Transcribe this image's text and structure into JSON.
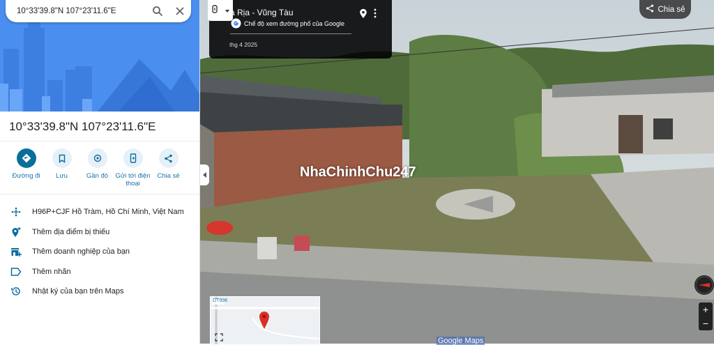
{
  "search": {
    "query": "10°33'39.8\"N 107°23'11.6\"E",
    "search_icon": "search-icon",
    "close_icon": "close-icon"
  },
  "place": {
    "title": "10°33'39.8\"N 107°23'11.6\"E"
  },
  "actions": [
    {
      "label": "Đường đi",
      "icon": "directions-icon"
    },
    {
      "label": "Lưu",
      "icon": "bookmark-icon"
    },
    {
      "label": "Gần đó",
      "icon": "nearby-icon"
    },
    {
      "label": "Gửi tới điện thoại",
      "icon": "send-to-phone-icon"
    },
    {
      "label": "Chia sẻ",
      "icon": "share-icon"
    }
  ],
  "details": [
    {
      "text": "H96P+CJF Hồ Tràm, Hồ Chí Minh, Việt Nam",
      "icon": "plus-code-icon"
    },
    {
      "text": "Thêm địa điểm bị thiếu",
      "icon": "add-place-icon"
    },
    {
      "text": "Thêm doanh nghiệp của bạn",
      "icon": "add-business-icon"
    },
    {
      "text": "Thêm nhãn",
      "icon": "label-icon"
    },
    {
      "text": "Nhật ký của bạn trên Maps",
      "icon": "history-icon"
    }
  ],
  "streetview": {
    "location": "à Rịa - Vũng Tàu",
    "subtitle": "Chế độ xem đường phố của Google",
    "date": "thg 4 2025",
    "share_label": "Chia sẻ",
    "watermark": "NhaChinhChu247",
    "map_label": "Google Maps",
    "minimap_road": "DT998"
  },
  "colors": {
    "accent": "#0b6e99",
    "link": "#1a73a8"
  }
}
